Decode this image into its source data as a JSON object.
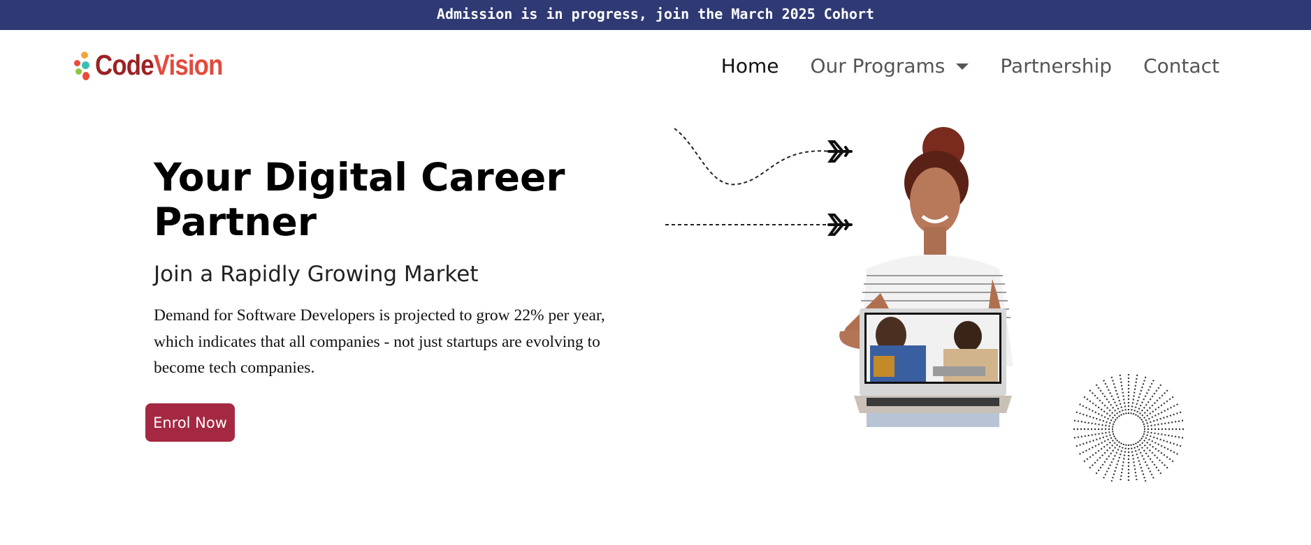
{
  "announcement": "Admission is in progress, join the March 2025 Cohort",
  "logo": {
    "part1": "Code",
    "part2": "Vision"
  },
  "nav": {
    "items": [
      {
        "label": "Home"
      },
      {
        "label": "Our Programs"
      },
      {
        "label": "Partnership"
      },
      {
        "label": "Contact"
      }
    ]
  },
  "hero": {
    "title": "Your Digital Career Partner",
    "subtitle": "Join a Rapidly Growing Market",
    "body": "Demand for Software Developers is projected to grow 22% per year, which indicates that all companies - not just startups are evolving to become tech companies.",
    "cta_label": "Enrol Now"
  },
  "colors": {
    "banner_bg": "#2f3a74",
    "cta_bg": "#a52842",
    "logo_dark_red": "#9c2224",
    "logo_red": "#e34a3d"
  }
}
